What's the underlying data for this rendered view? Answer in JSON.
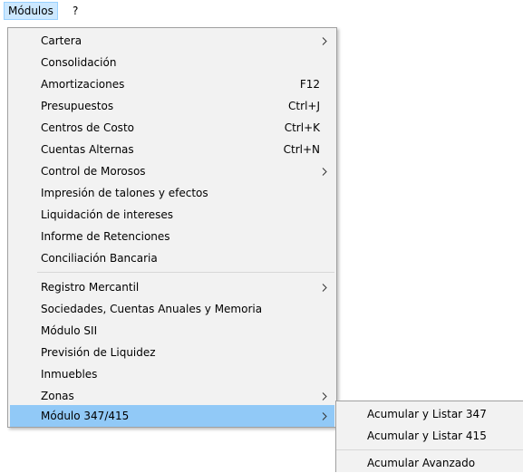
{
  "menubar": {
    "items": [
      {
        "label": "Módulos"
      },
      {
        "label": "?"
      }
    ]
  },
  "modulos_menu": {
    "items": [
      {
        "label": "Cartera",
        "shortcut": "",
        "submenu": true
      },
      {
        "label": "Consolidación",
        "shortcut": ""
      },
      {
        "label": "Amortizaciones",
        "shortcut": "F12"
      },
      {
        "label": "Presupuestos",
        "shortcut": "Ctrl+J"
      },
      {
        "label": "Centros de Costo",
        "shortcut": "Ctrl+K"
      },
      {
        "label": "Cuentas Alternas",
        "shortcut": "Ctrl+N"
      },
      {
        "label": "Control de Morosos",
        "shortcut": "",
        "submenu": true
      },
      {
        "label": "Impresión de talones y efectos",
        "shortcut": ""
      },
      {
        "label": "Liquidación de intereses",
        "shortcut": ""
      },
      {
        "label": "Informe de Retenciones",
        "shortcut": ""
      },
      {
        "label": "Conciliación Bancaria",
        "shortcut": ""
      },
      {
        "label": "Registro Mercantil",
        "shortcut": "",
        "submenu": true
      },
      {
        "label": "Sociedades, Cuentas Anuales y Memoria",
        "shortcut": ""
      },
      {
        "label": "Módulo SII",
        "shortcut": ""
      },
      {
        "label": "Previsión de Liquidez",
        "shortcut": ""
      },
      {
        "label": "Inmuebles",
        "shortcut": ""
      },
      {
        "label": "Zonas",
        "shortcut": "",
        "submenu": true
      },
      {
        "label": "Módulo 347/415",
        "shortcut": "",
        "submenu": true,
        "highlighted": true
      }
    ]
  },
  "submenu_347": {
    "items": [
      {
        "label": "Acumular y Listar 347"
      },
      {
        "label": "Acumular y Listar 415"
      },
      {
        "label": "Acumular Avanzado"
      }
    ]
  },
  "colors": {
    "menu_bg": "#f2f2f2",
    "highlight": "#91c9f7",
    "menubar_active": "#cce8ff"
  }
}
